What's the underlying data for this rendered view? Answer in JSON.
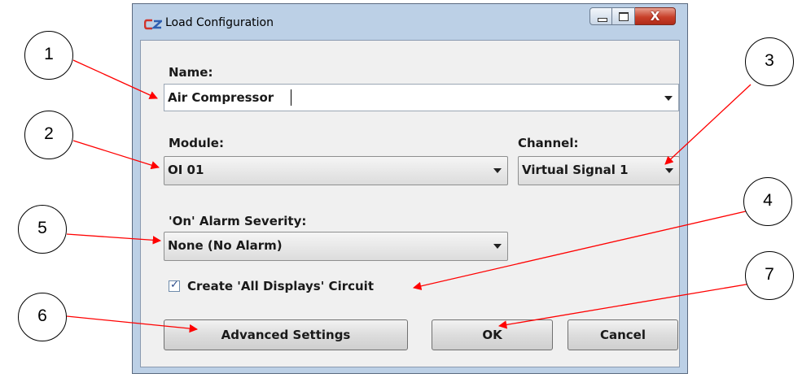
{
  "window": {
    "title": "Load Configuration",
    "app_icon": "cz-logo-icon",
    "controls": {
      "minimize": "minimize-icon",
      "maximize": "maximize-icon",
      "close_symbol": "X"
    }
  },
  "form": {
    "name_label": "Name:",
    "name_value": "Air Compressor",
    "module_label": "Module:",
    "module_value": "OI 01",
    "channel_label": "Channel:",
    "channel_value": "Virtual Signal 1",
    "alarm_label": "'On' Alarm Severity:",
    "alarm_value": "None (No Alarm)",
    "checkbox_label": "Create 'All Displays' Circuit",
    "checkbox_checked": true,
    "checkmark": "✓"
  },
  "buttons": {
    "advanced": "Advanced Settings",
    "ok": "OK",
    "cancel": "Cancel"
  },
  "annotations": {
    "callouts": [
      "1",
      "2",
      "3",
      "4",
      "5",
      "6",
      "7"
    ],
    "arrow_color": "#ff0000"
  }
}
